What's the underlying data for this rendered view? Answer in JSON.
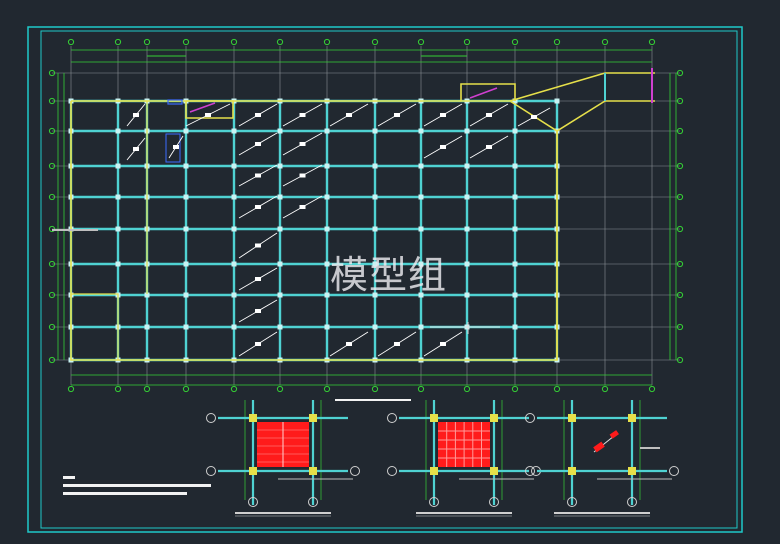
{
  "watermark": {
    "text": "模型组"
  },
  "colors": {
    "background": "#212830",
    "frame": "#1fc9c9",
    "column_grid": "#4fd2d2",
    "boundary": "#e6e04a",
    "beam": "#9fd8df",
    "grid_line": "#8a8f96",
    "dim_line": "#35d035",
    "rebar": "#ff1b1b",
    "brace": "#ffffff",
    "magenta": "#d040d0"
  },
  "icons": [
    "axis-bubble-icon",
    "section-callout-icon",
    "brace-symbol-icon"
  ],
  "details": [
    {
      "id": "detail-a",
      "fill": "solid-rebar"
    },
    {
      "id": "detail-b",
      "fill": "grid-rebar"
    },
    {
      "id": "detail-c",
      "fill": "corner-rebar"
    }
  ]
}
